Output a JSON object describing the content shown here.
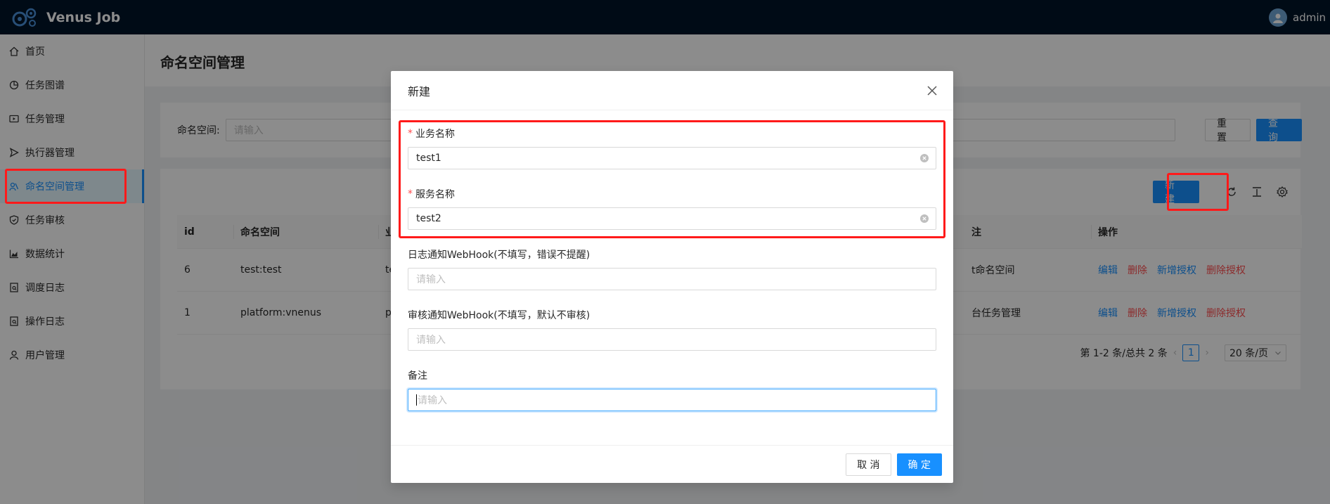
{
  "app": {
    "title": "Venus Job",
    "user": "admin"
  },
  "sidebar": {
    "items": [
      {
        "label": "首页",
        "icon": "home-icon"
      },
      {
        "label": "任务图谱",
        "icon": "pie-chart-icon"
      },
      {
        "label": "任务管理",
        "icon": "play-square-icon"
      },
      {
        "label": "执行器管理",
        "icon": "send-icon"
      },
      {
        "label": "命名空间管理",
        "icon": "team-icon",
        "active": true
      },
      {
        "label": "任务审核",
        "icon": "audit-icon"
      },
      {
        "label": "数据统计",
        "icon": "area-chart-icon"
      },
      {
        "label": "调度日志",
        "icon": "file-search-icon"
      },
      {
        "label": "操作日志",
        "icon": "file-search-icon"
      },
      {
        "label": "用户管理",
        "icon": "user-icon"
      }
    ]
  },
  "page": {
    "title": "命名空间管理"
  },
  "search": {
    "label": "命名空间:",
    "placeholder": "请输入",
    "reset_label": "重 置",
    "query_label": "查 询"
  },
  "toolbar": {
    "new_label": "新 建"
  },
  "table": {
    "columns": [
      "id",
      "命名空间",
      "业",
      "注",
      "操作"
    ],
    "rows": [
      {
        "id": "6",
        "namespace": "test:test",
        "business": "tes",
        "remark": "t命名空间"
      },
      {
        "id": "1",
        "namespace": "platform:vnenus",
        "business": "pla",
        "remark": "台任务管理"
      }
    ],
    "actions": {
      "edit": "编辑",
      "delete": "删除",
      "grant": "新增授权",
      "revoke": "删除授权"
    }
  },
  "pagination": {
    "summary": "第 1-2 条/总共 2 条",
    "current": "1",
    "page_size": "20 条/页"
  },
  "modal": {
    "title": "新建",
    "fields": [
      {
        "label": "业务名称",
        "required": true,
        "value": "test1"
      },
      {
        "label": "服务名称",
        "required": true,
        "value": "test2"
      },
      {
        "label": "日志通知WebHook(不填写，错误不提醒)",
        "required": false,
        "placeholder": "请输入"
      },
      {
        "label": "审核通知WebHook(不填写，默认不审核)",
        "required": false,
        "placeholder": "请输入"
      },
      {
        "label": "备注",
        "required": false,
        "placeholder": "请输入"
      }
    ],
    "cancel_label": "取 消",
    "ok_label": "确 定"
  },
  "colors": {
    "primary": "#1890ff",
    "header_bg": "#001529",
    "danger": "#ff4d4f",
    "highlight": "#ff1a1a"
  }
}
